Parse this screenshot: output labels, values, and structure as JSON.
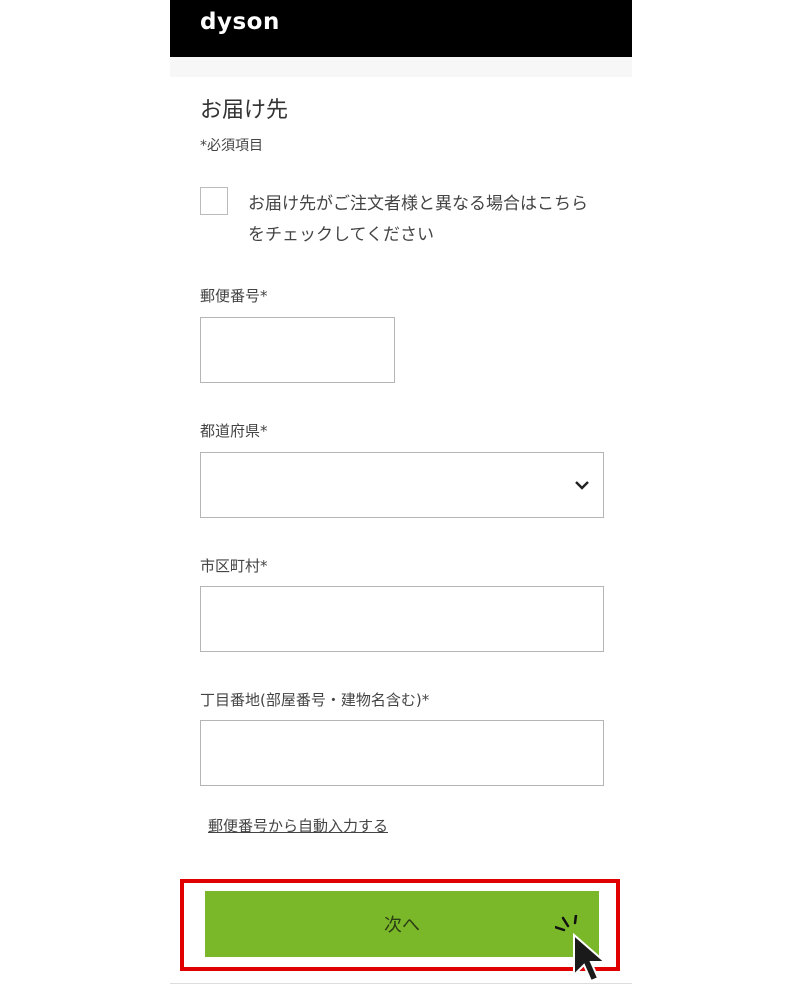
{
  "header": {
    "logo": "dyson"
  },
  "form": {
    "title": "お届け先",
    "required_note": "*必須項目",
    "checkbox_label_line1": "お届け先がご注文者様と異なる場合はこちら",
    "checkbox_label_line2": "をチェックしてください",
    "postal_code_label": "郵便番号*",
    "prefecture_label": "都道府県*",
    "city_label": "市区町村*",
    "address_label": "丁目番地(部屋番号・建物名含む)*",
    "postal_code_value": "",
    "prefecture_value": "",
    "city_value": "",
    "address_value": "",
    "autofill_link": "郵便番号から自動入力する",
    "next_button": "次へ"
  },
  "colors": {
    "header_bg": "#000000",
    "button_bg": "#7ab829",
    "highlight": "#e00000"
  },
  "icons": [
    "chevron-down-icon",
    "cursor-pointer-icon",
    "click-sparkle-icon"
  ]
}
